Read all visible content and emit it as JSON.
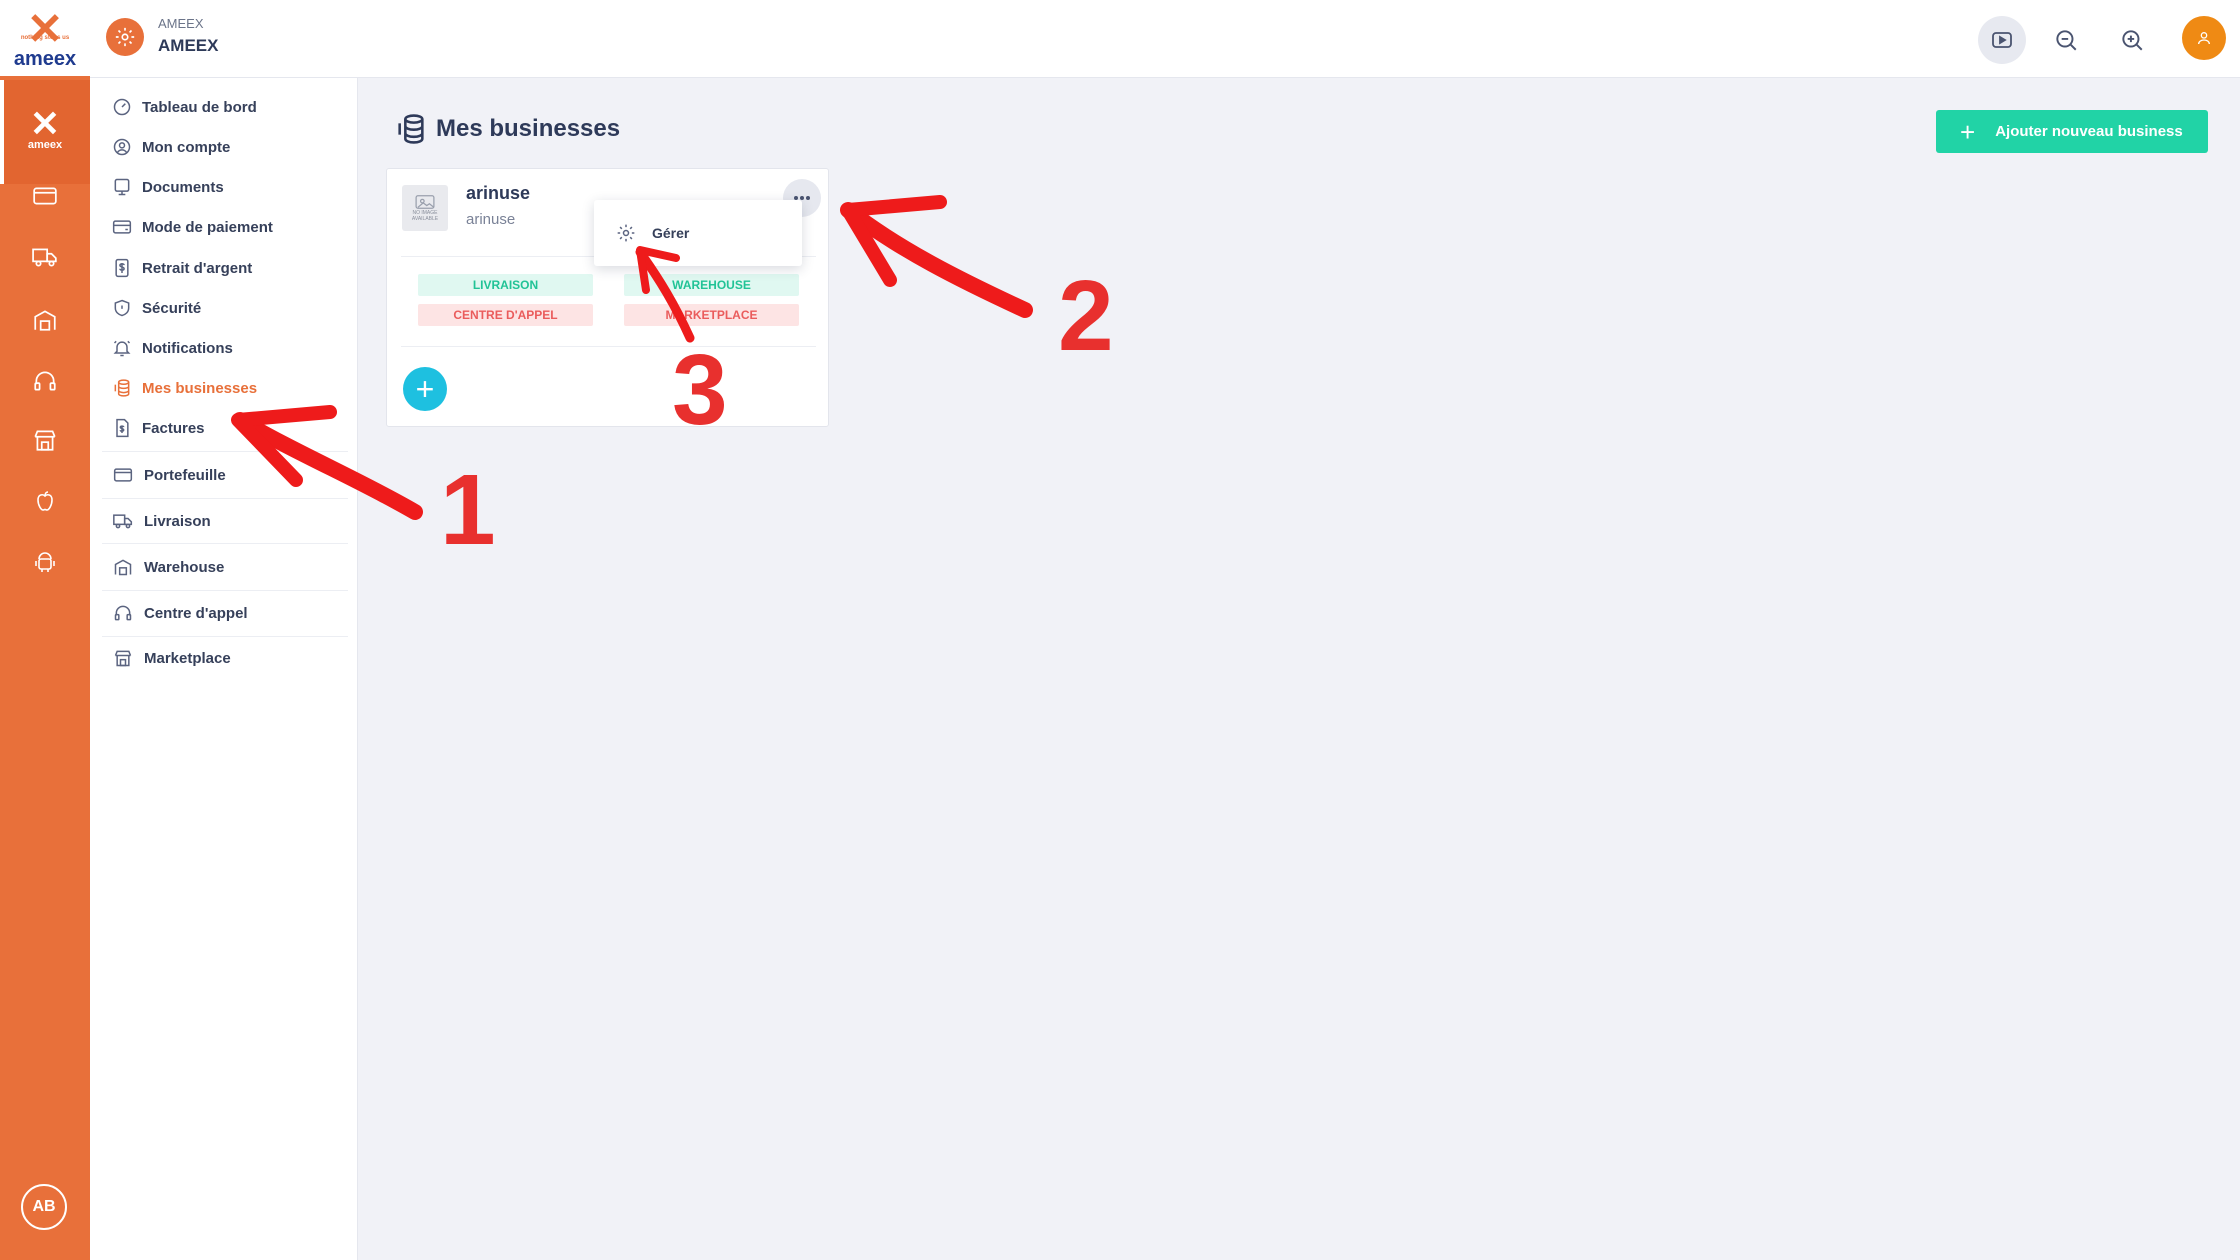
{
  "rail": {
    "logo_word": "ameex",
    "logo_tag": "nothing stops us",
    "active_mark_word": "ameex",
    "icons": [
      "wallet-icon",
      "truck-icon",
      "warehouse-icon",
      "headset-icon",
      "store-icon",
      "apple-icon",
      "android-icon"
    ],
    "avatar_initials": "AB"
  },
  "topbar": {
    "business_small": "AMEEX",
    "business_name": "AMEEX"
  },
  "menu": {
    "items": [
      {
        "label": "Tableau de bord",
        "icon": "dashboard-icon"
      },
      {
        "label": "Mon compte",
        "icon": "user-circle-icon"
      },
      {
        "label": "Documents",
        "icon": "document-icon"
      },
      {
        "label": "Mode de paiement",
        "icon": "credit-card-icon"
      },
      {
        "label": "Retrait d'argent",
        "icon": "money-receipt-icon"
      },
      {
        "label": "Sécurité",
        "icon": "shield-icon"
      },
      {
        "label": "Notifications",
        "icon": "bell-icon"
      },
      {
        "label": "Mes businesses",
        "icon": "coins-icon"
      },
      {
        "label": "Factures",
        "icon": "invoice-icon"
      },
      {
        "label": "Portefeuille",
        "icon": "wallet-icon"
      },
      {
        "label": "Livraison",
        "icon": "truck-icon"
      },
      {
        "label": "Warehouse",
        "icon": "warehouse-icon"
      },
      {
        "label": "Centre d'appel",
        "icon": "headset-icon"
      },
      {
        "label": "Marketplace",
        "icon": "store-icon"
      }
    ],
    "active_index": 7
  },
  "main": {
    "title": "Mes businesses",
    "add_button_label": "Ajouter nouveau business"
  },
  "card": {
    "thumb_text": "NO IMAGE AVAILABLE",
    "name": "arinuse",
    "subtitle": "arinuse",
    "tags": [
      {
        "label": "LIVRAISON",
        "color": "green"
      },
      {
        "label": "WAREHOUSE",
        "color": "green"
      },
      {
        "label": "CENTRE D'APPEL",
        "color": "red"
      },
      {
        "label": "MARKETPLACE",
        "color": "red"
      }
    ]
  },
  "dropdown": {
    "items": [
      {
        "label": "Gérer",
        "icon": "gear-icon"
      }
    ]
  },
  "annotations": {
    "numbers": [
      "1",
      "2",
      "3"
    ],
    "color": "#e8302e"
  },
  "colors": {
    "brand_orange": "#e8703a",
    "brand_blue": "#1f3b8f",
    "accent_green": "#21d3a6",
    "accent_cyan": "#1ec0e0"
  }
}
